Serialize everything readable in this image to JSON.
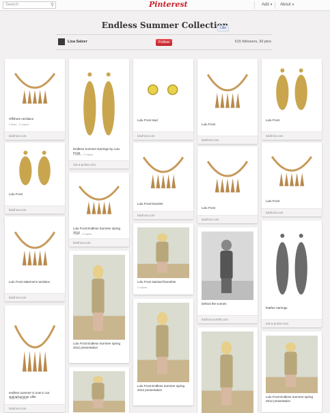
{
  "header": {
    "search_placeholder": "Search",
    "logo": "Pinterest",
    "nav": [
      {
        "label": "Add"
      },
      {
        "label": "About"
      }
    ]
  },
  "board": {
    "title": "Endless Summer Collection",
    "like_label": "Like",
    "owner": "Lisa Salzer",
    "follow_label": "Follow",
    "stats": "615 followers, 30 pins"
  },
  "pins": [
    {
      "desc": "Offshore necklace",
      "meta": "2 likes · 2 repins",
      "source": "lulufrost.com",
      "img": "necklace"
    },
    {
      "desc": "Lulu Frost",
      "meta": "",
      "source": "lulufrost.com",
      "img": "earring-gold"
    },
    {
      "desc": "Lulu Frost statement necklace",
      "meta": "",
      "source": "lulufrost.com",
      "img": "necklace"
    },
    {
      "desc": "endless summer is now in our spring/summer offer",
      "meta": "1 like · 2 repins",
      "source": "lulufrost.com",
      "img": "necklace"
    },
    {
      "desc": "Lulu Frost Fearless Summer spring 2012 presentation",
      "meta": "",
      "source": "",
      "img": "photo"
    },
    {
      "desc": "Endless Summer Earrings by Lulu Frost",
      "meta": "2 likes · 2 repins",
      "source": "net-a-porter.com",
      "img": "earring-gold"
    },
    {
      "desc": "Lulu Frost Endless Summer spring 2012",
      "meta": "1 like · 2 repins",
      "source": "lulufrost.com",
      "img": "necklace"
    },
    {
      "desc": "Lulu Frost Endless Summer spring 2012 presentation",
      "meta": "",
      "source": "",
      "img": "photo"
    },
    {
      "desc": "Lulu Frost Endless Summer spring 2012 presentation",
      "meta": "",
      "source": "",
      "img": "photo"
    },
    {
      "desc": "Lulu Frost stud",
      "meta": "",
      "source": "lulufrost.com",
      "img": "stud"
    },
    {
      "desc": "Lulu Frost bracelet",
      "meta": "",
      "source": "lulufrost.com",
      "img": "necklace"
    },
    {
      "desc": "Lulu Frost stacked bracelets",
      "meta": "2 repins",
      "source": "",
      "img": "photo"
    },
    {
      "desc": "Lulu Frost Endless Summer spring 2012 presentation",
      "meta": "",
      "source": "",
      "img": "photo"
    },
    {
      "desc": "Lulu Frost",
      "meta": "",
      "source": "lulufrost.com",
      "img": "necklace"
    },
    {
      "desc": "Lulu Frost",
      "meta": "",
      "source": "lulufrost.com",
      "img": "necklace"
    },
    {
      "desc": "behind the scenes",
      "meta": "",
      "source": "lulufrost.tumblr.com",
      "img": "photo-bw"
    },
    {
      "desc": "",
      "meta": "",
      "source": "",
      "img": "photo"
    },
    {
      "desc": "Lulu Frost",
      "meta": "",
      "source": "lulufrost.com",
      "img": "earring-gold"
    },
    {
      "desc": "Lulu Frost",
      "meta": "",
      "source": "lulufrost.com",
      "img": "necklace"
    },
    {
      "desc": "feather earrings",
      "meta": "",
      "source": "net-a-porter.com",
      "img": "earring-dark"
    },
    {
      "desc": "Lulu Frost Endless Summer spring 2012 presentation",
      "meta": "",
      "source": "",
      "img": "photo"
    }
  ],
  "colors": {
    "brand": "#c8232c",
    "background": "#f2f0f0"
  }
}
